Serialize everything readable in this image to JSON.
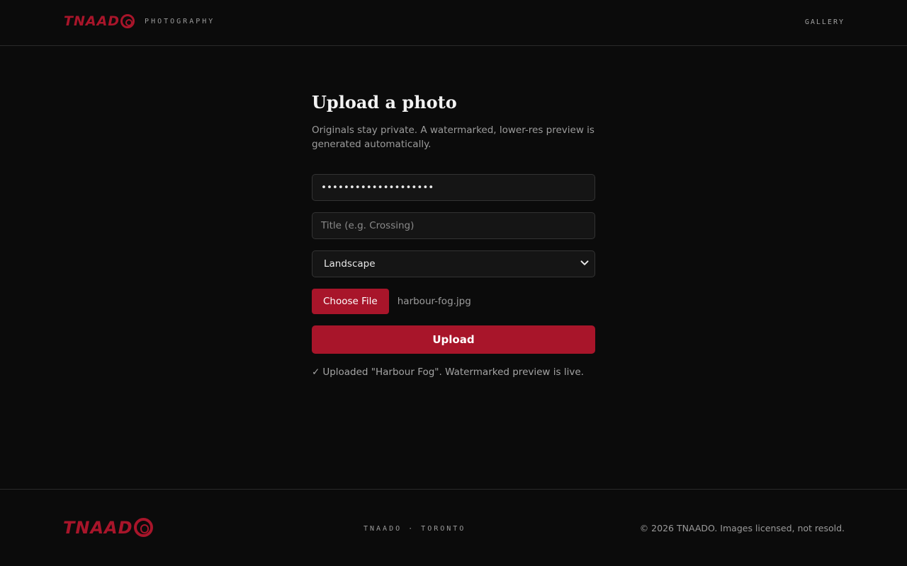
{
  "header": {
    "logo": "TNAADO",
    "brand_sub": "PHOTOGRAPHY",
    "nav_gallery": "GALLERY"
  },
  "main": {
    "title": "Upload a photo",
    "description": "Originals stay private. A watermarked, lower-res preview is generated automatically.",
    "password_value": "••••••••••••••••••••",
    "title_placeholder": "Title (e.g. Crossing)",
    "category_selected": "Landscape",
    "choose_file_label": "Choose File",
    "file_name": "harbour-fog.jpg",
    "upload_label": "Upload",
    "status_message": "Uploaded \"Harbour Fog\". Watermarked preview is live."
  },
  "footer": {
    "logo": "TNAADO",
    "center_text": "TNAADO · TORONTO",
    "copyright": "© 2026 TNAADO. Images licensed, not resold."
  },
  "colors": {
    "accent": "#a8152a",
    "background": "#0b0b0b"
  },
  "icons": {
    "status": "check-icon",
    "select": "chevron-down-icon"
  }
}
